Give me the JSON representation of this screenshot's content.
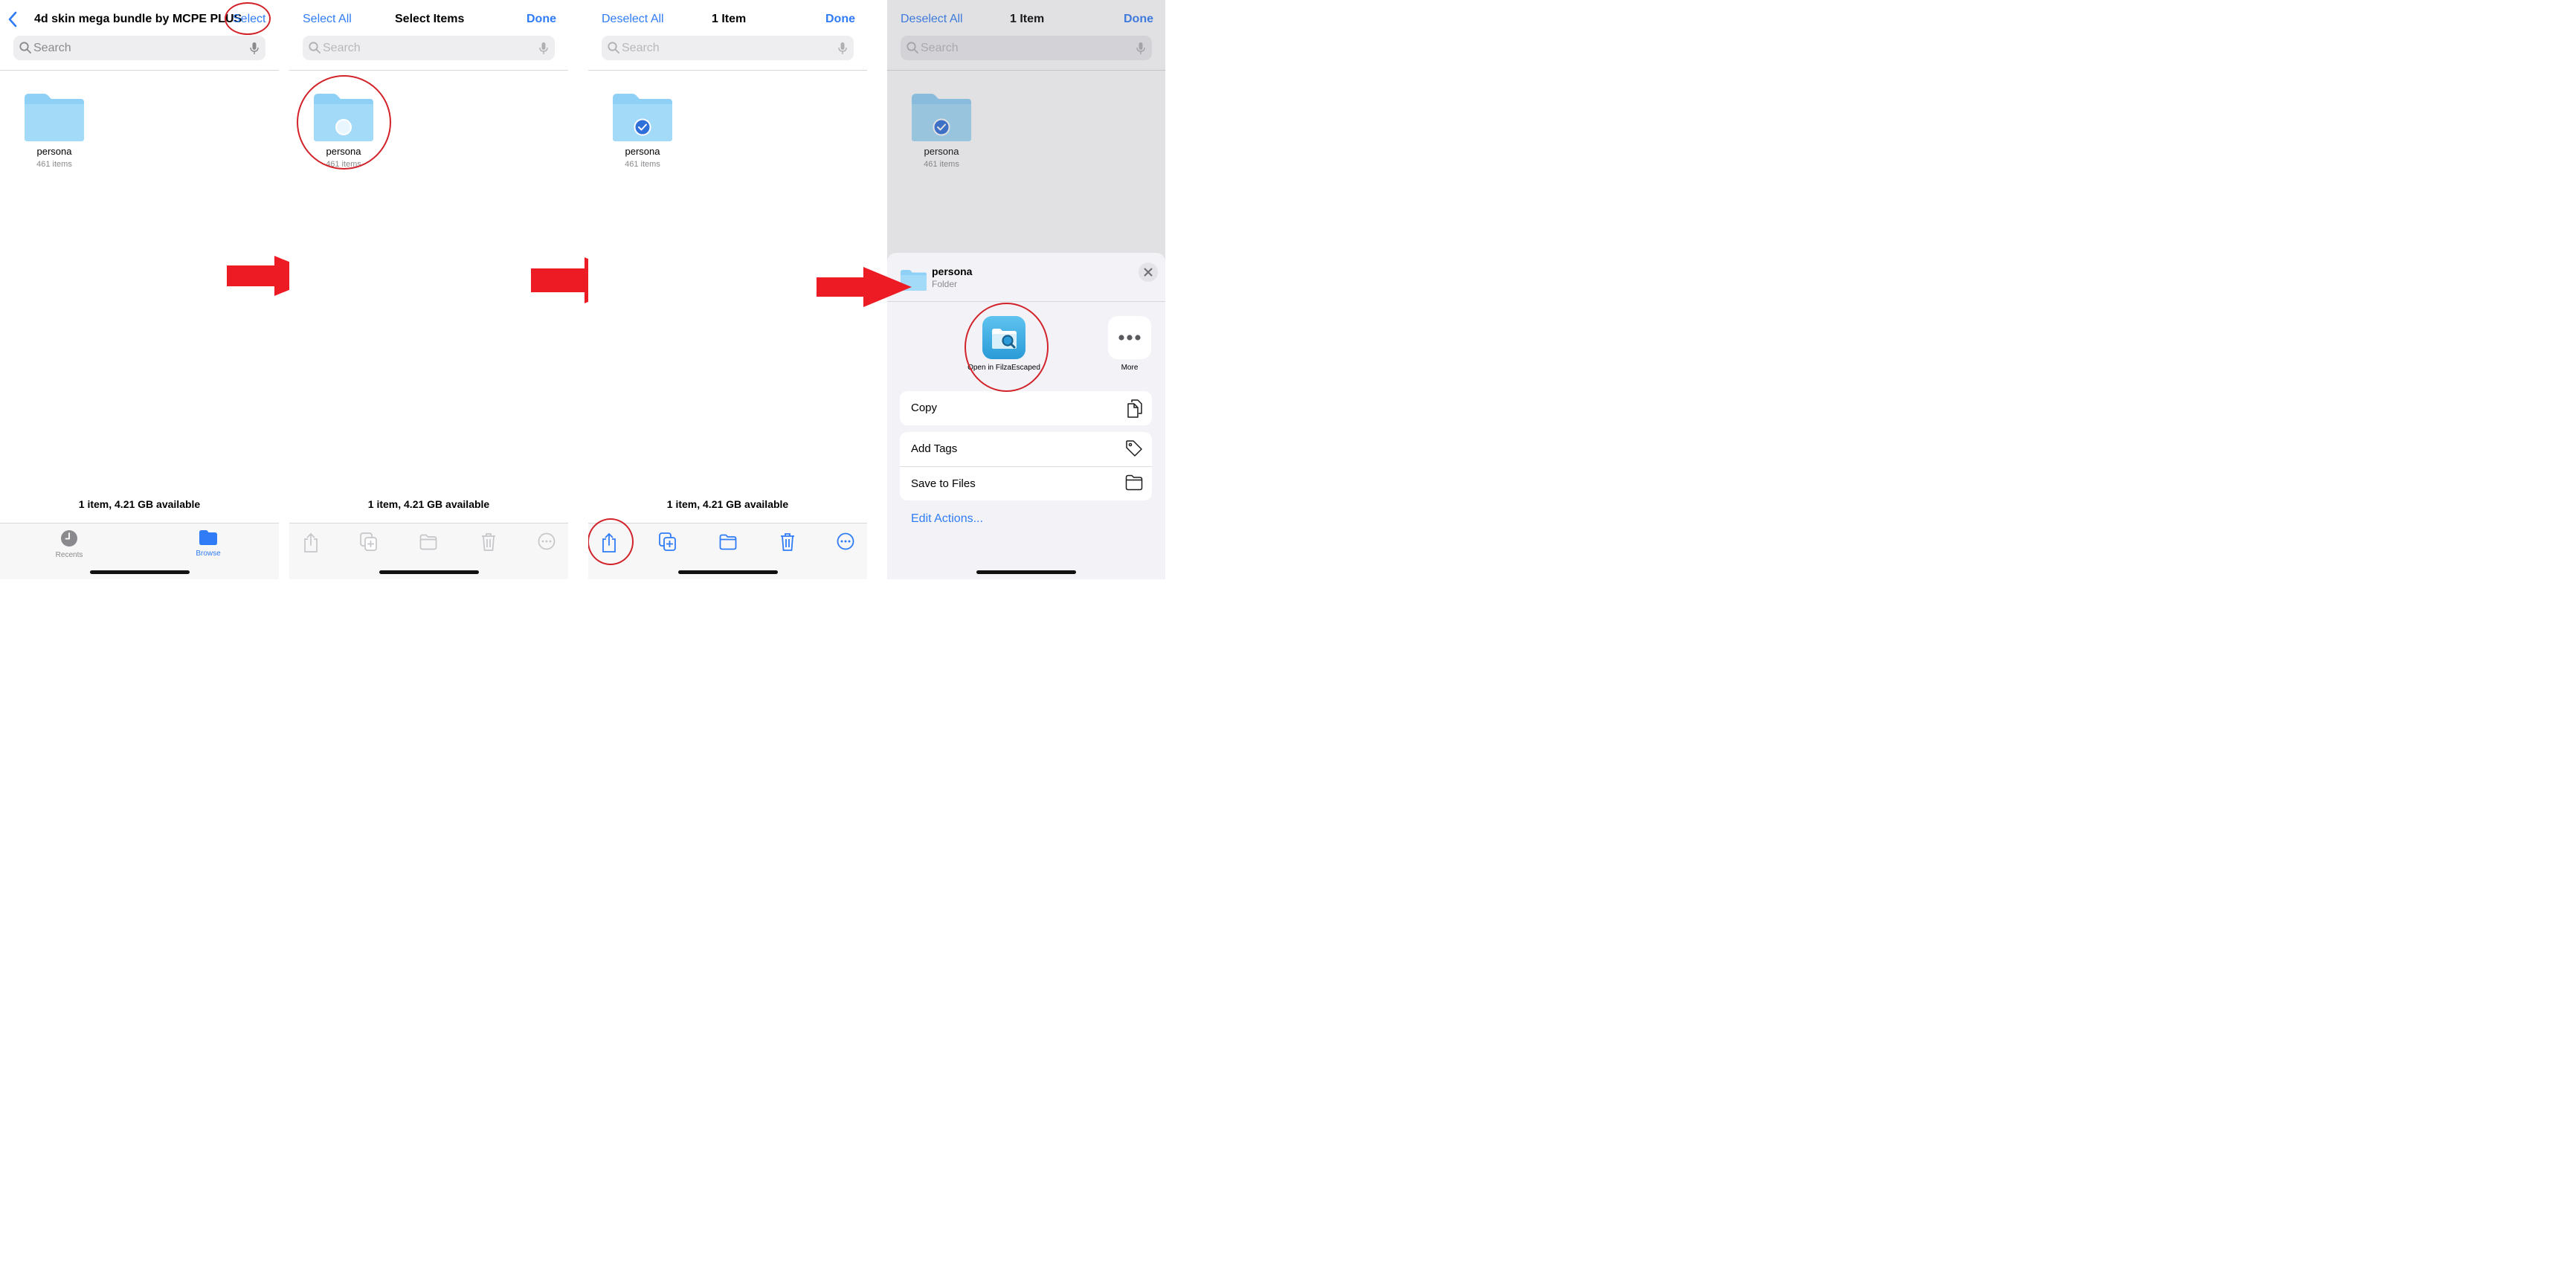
{
  "colors": {
    "accent": "#2f7cf6",
    "annotation": "#d2232a",
    "folder": "#8fd0f6"
  },
  "search": {
    "placeholder": "Search"
  },
  "panel1": {
    "back_icon": "chevron-left-icon",
    "title": "4d skin mega bundle by MCPE PLUS",
    "select_label": "Select",
    "folder": {
      "name": "persona",
      "count": "461 items"
    },
    "status": "1 item, 4.21 GB available",
    "tabs": [
      {
        "label": "Recents",
        "icon": "clock-icon"
      },
      {
        "label": "Browse",
        "icon": "folder-icon",
        "active": true
      }
    ]
  },
  "panel2": {
    "left_label": "Select All",
    "title": "Select Items",
    "right_label": "Done",
    "folder": {
      "name": "persona",
      "count": "461 items",
      "selected": false
    },
    "status": "1 item, 4.21 GB available",
    "toolbar": [
      "share-icon",
      "duplicate-icon",
      "move-folder-icon",
      "trash-icon",
      "more-icon"
    ],
    "toolbar_enabled": false
  },
  "panel3": {
    "left_label": "Deselect All",
    "title": "1 Item",
    "right_label": "Done",
    "folder": {
      "name": "persona",
      "count": "461 items",
      "selected": true
    },
    "status": "1 item, 4.21 GB available",
    "toolbar": [
      "share-icon",
      "duplicate-icon",
      "move-folder-icon",
      "trash-icon",
      "more-icon"
    ],
    "toolbar_enabled": true
  },
  "panel4": {
    "left_label": "Deselect All",
    "title": "1 Item",
    "right_label": "Done",
    "folder": {
      "name": "persona",
      "count": "461 items",
      "selected": true
    },
    "sheet": {
      "item_name": "persona",
      "item_kind": "Folder",
      "apps": [
        {
          "label": "Open in FilzaEscaped",
          "icon": "filza-app-icon"
        },
        {
          "label": "More",
          "icon": "ellipsis-icon"
        }
      ],
      "actions_group1": [
        {
          "label": "Copy",
          "icon": "copy-icon"
        }
      ],
      "actions_group2": [
        {
          "label": "Add Tags",
          "icon": "tag-icon"
        },
        {
          "label": "Save to Files",
          "icon": "folder-outline-icon"
        }
      ],
      "edit_actions": "Edit Actions..."
    }
  }
}
